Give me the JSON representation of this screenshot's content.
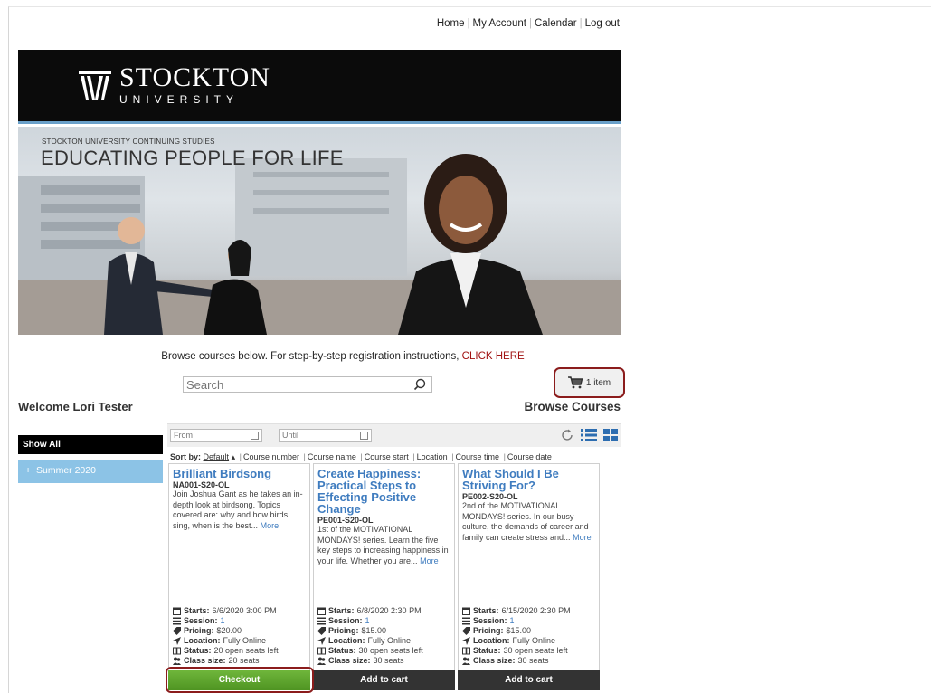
{
  "topnav": {
    "home": "Home",
    "account": "My Account",
    "calendar": "Calendar",
    "logout": "Log out"
  },
  "logo": {
    "line1": "STOCKTON",
    "line2": "UNIVERSITY"
  },
  "banner": {
    "small": "STOCKTON UNIVERSITY CONTINUING STUDIES",
    "big": "EDUCATING PEOPLE FOR LIFE"
  },
  "instructions": {
    "text": "Browse courses below. For step-by-step registration instructions,",
    "link": "CLICK HERE"
  },
  "search": {
    "placeholder": "Search"
  },
  "cart": {
    "label": "1 item"
  },
  "welcome": "Welcome Lori Tester",
  "browse_title": "Browse Courses",
  "sidebar": {
    "show_all": "Show All",
    "items": [
      {
        "label": "Summer 2020",
        "prefix": "+"
      }
    ]
  },
  "filters": {
    "from": "From",
    "until": "Until"
  },
  "sort": {
    "label": "Sort by:",
    "default": "Default",
    "options": [
      "Course number",
      "Course name",
      "Course start",
      "Location",
      "Course time",
      "Course date"
    ]
  },
  "labels": {
    "starts": "Starts:",
    "session": "Session:",
    "pricing": "Pricing:",
    "location": "Location:",
    "status": "Status:",
    "class_size": "Class size:"
  },
  "courses": [
    {
      "title": "Brilliant Birdsong",
      "code": "NA001-S20-OL",
      "desc": "Join Joshua Gant as he takes an in-depth look at birdsong. Topics covered are: why and how birds sing, when is the best...",
      "more": "More",
      "starts": "6/6/2020 3:00 PM",
      "session": "1",
      "pricing": "$20.00",
      "location": "Fully Online",
      "status": "20 open seats left",
      "class_size": "20 seats",
      "button": "Checkout"
    },
    {
      "title": "Create Happiness: Practical Steps to Effecting Positive Change",
      "code": "PE001-S20-OL",
      "desc": "1st of the MOTIVATIONAL MONDAYS! series. Learn the five key steps to increasing happiness in your life. Whether you are...",
      "more": "More",
      "starts": "6/8/2020 2:30 PM",
      "session": "1",
      "pricing": "$15.00",
      "location": "Fully Online",
      "status": "30 open seats left",
      "class_size": "30 seats",
      "button": "Add to cart"
    },
    {
      "title": "What Should I Be Striving For?",
      "code": "PE002-S20-OL",
      "desc": "2nd of the MOTIVATIONAL MONDAYS! series. In our busy culture, the demands of career and family can create stress and...",
      "more": "More",
      "starts": "6/15/2020 2:30 PM",
      "session": "1",
      "pricing": "$15.00",
      "location": "Fully Online",
      "status": "30 open seats left",
      "class_size": "30 seats",
      "button": "Add to cart"
    }
  ],
  "colors": {
    "accent_blue": "#3f7cbf",
    "checkout_green": "#5aa52b",
    "highlight_red": "#8b1c1c",
    "sidebar_blue": "#8cc3e6"
  }
}
